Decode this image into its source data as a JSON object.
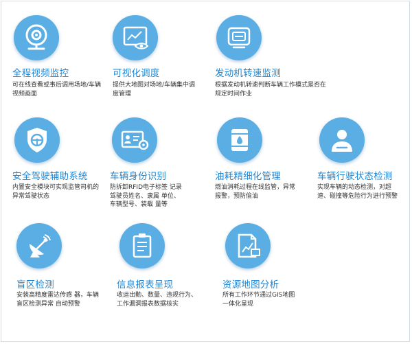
{
  "features": [
    {
      "title": "全程视频监控",
      "desc": "可在线查看或事后调用场地/车辆视频画面",
      "icon": "webcam-icon"
    },
    {
      "title": "可视化调度",
      "desc": "提供大地图对场地/车辆集中调度管理",
      "icon": "monitor-eye-icon"
    },
    {
      "title": "发动机转速监测",
      "desc": "根据发动机转速判断车辆工作模式是否在规定时间作业",
      "icon": "engine-meter-icon"
    },
    {
      "title": "安全驾驶辅助系统",
      "desc": "内置安全模块可实现监管司机的异常驾驶状态",
      "icon": "shield-steering-icon"
    },
    {
      "title": "车辆身份识别",
      "desc": "防拆卸RFID电子标签 记录驾驶员姓名、隶属 单位、车辆型号、装载 量等",
      "icon": "id-card-gear-icon"
    },
    {
      "title": "油耗精细化管理",
      "desc": "燃油消耗过程在线监管，异常报警，预防偷油",
      "icon": "oil-barrel-icon"
    },
    {
      "title": "车辆行驶状态检测",
      "desc": "实现车辆的动态检测，对超速、碰撞等危险行为进行预警",
      "icon": "driver-icon"
    },
    {
      "title": "盲区检测",
      "desc": "安装高精度雷达传感 器，车辆盲区检测异常 自动预警",
      "icon": "radar-dish-icon"
    },
    {
      "title": "信息报表呈现",
      "desc": "收运出勤、数量、违规行为、工作漏洞报表数据核实",
      "icon": "clipboard-report-icon"
    },
    {
      "title": "资源地图分析",
      "desc": "所有工作环节通过GIS地图一体化呈现",
      "icon": "chart-map-icon"
    }
  ],
  "colors": {
    "accent": "#5aaee4",
    "title": "#1e87d6",
    "text": "#333333",
    "border": "#d2dbe3"
  }
}
